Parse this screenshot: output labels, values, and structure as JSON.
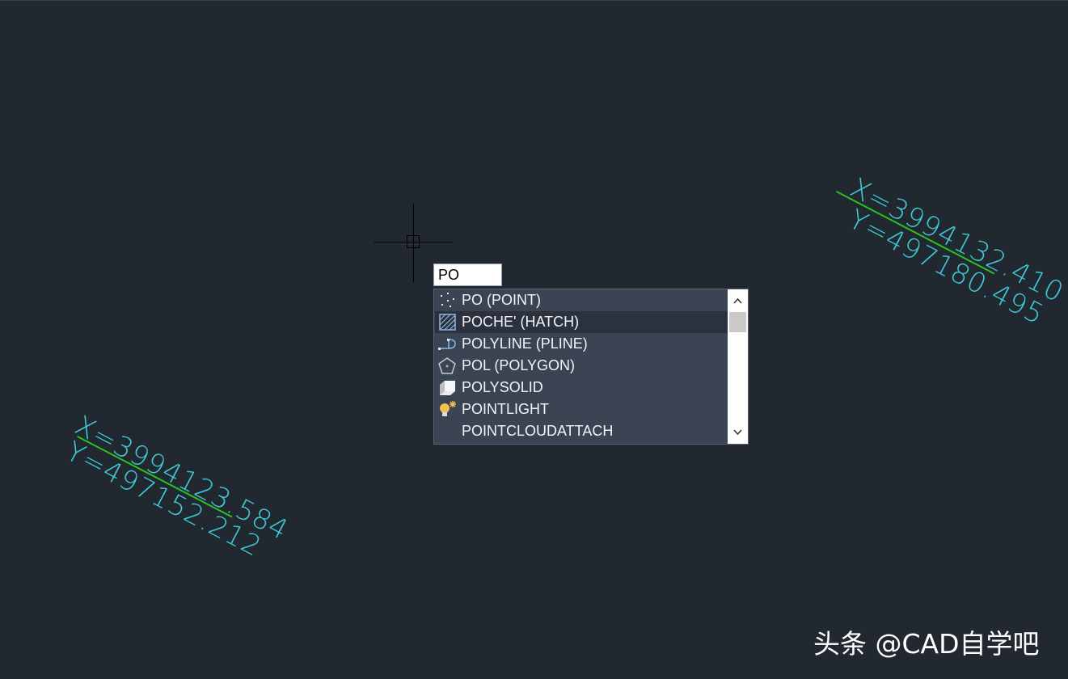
{
  "command_input": {
    "value": "PO"
  },
  "autocomplete": {
    "items": [
      {
        "label": "PO (POINT)",
        "icon": "point-icon"
      },
      {
        "label": "POCHE' (HATCH)",
        "icon": "hatch-icon",
        "selected": true
      },
      {
        "label": "POLYLINE (PLINE)",
        "icon": "polyline-icon"
      },
      {
        "label": "POL (POLYGON)",
        "icon": "polygon-icon"
      },
      {
        "label": "POLYSOLID",
        "icon": "polysolid-icon"
      },
      {
        "label": "POINTLIGHT",
        "icon": "pointlight-icon"
      },
      {
        "label": "POINTCLOUDATTACH",
        "icon": ""
      }
    ]
  },
  "coordinates": {
    "right": {
      "x": "X=3994132.410",
      "y": "Y=497180.495"
    },
    "left": {
      "x": "X=3994123.584",
      "y": "Y=497152.212"
    }
  },
  "colors": {
    "background": "#212830",
    "annotation_text": "#3ec9d6",
    "leader_line": "#29c21e"
  },
  "watermark": "头条 @CAD自学吧"
}
